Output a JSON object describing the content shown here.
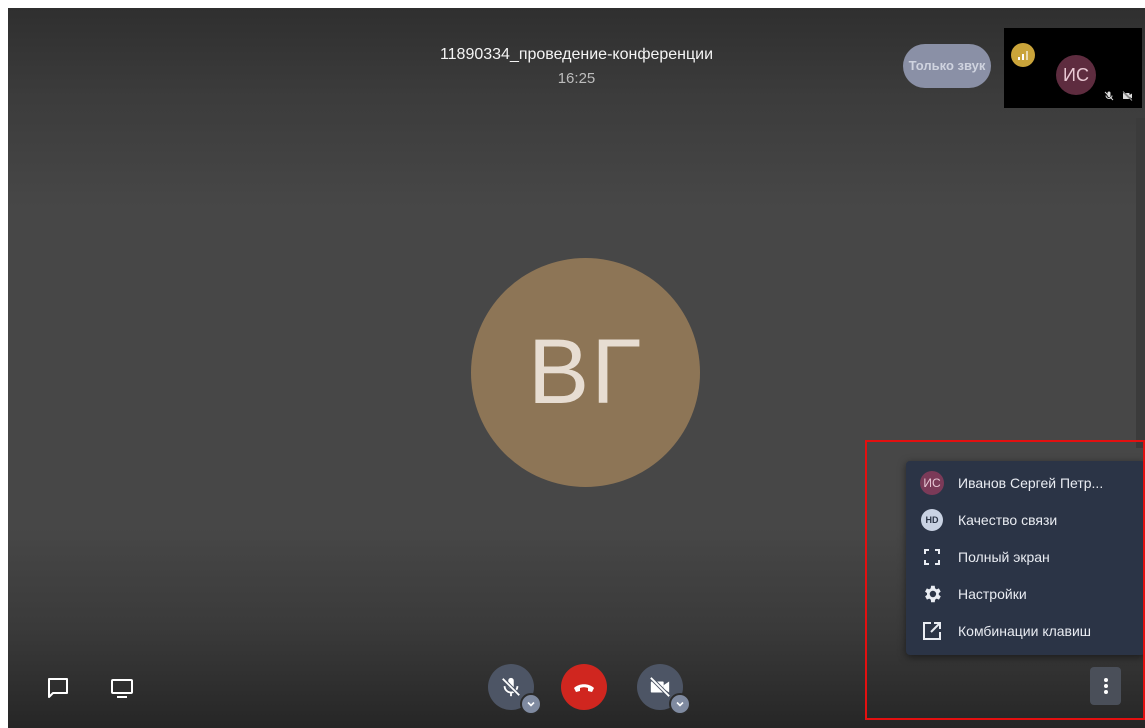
{
  "header": {
    "title": "11890334_проведение-конференции",
    "time": "16:25"
  },
  "audio_only_label": "Только звук",
  "self_tile": {
    "initials": "ИС",
    "signal_icon": "signal-bars-icon",
    "status_icons": [
      "mic-off-icon",
      "camera-off-icon"
    ]
  },
  "main_participant": {
    "initials": "ВГ",
    "color": "#8d7556"
  },
  "controls": {
    "left": [
      "chat-icon",
      "screen-share-icon"
    ],
    "center": [
      "mic-off-icon",
      "hang-up-icon",
      "camera-off-icon"
    ],
    "hangup_color": "#d0261f",
    "more": "more-vertical-icon"
  },
  "menu": {
    "items": [
      {
        "icon": "avatar",
        "initials": "ИС",
        "label": "Иванов Сергей Петр..."
      },
      {
        "icon": "hd-icon",
        "badge": "HD",
        "label": "Качество связи"
      },
      {
        "icon": "fullscreen-icon",
        "label": "Полный экран"
      },
      {
        "icon": "gear-icon",
        "label": "Настройки"
      },
      {
        "icon": "external-link-icon",
        "label": "Комбинации клавиш"
      }
    ]
  },
  "highlight_color": "#e31010"
}
